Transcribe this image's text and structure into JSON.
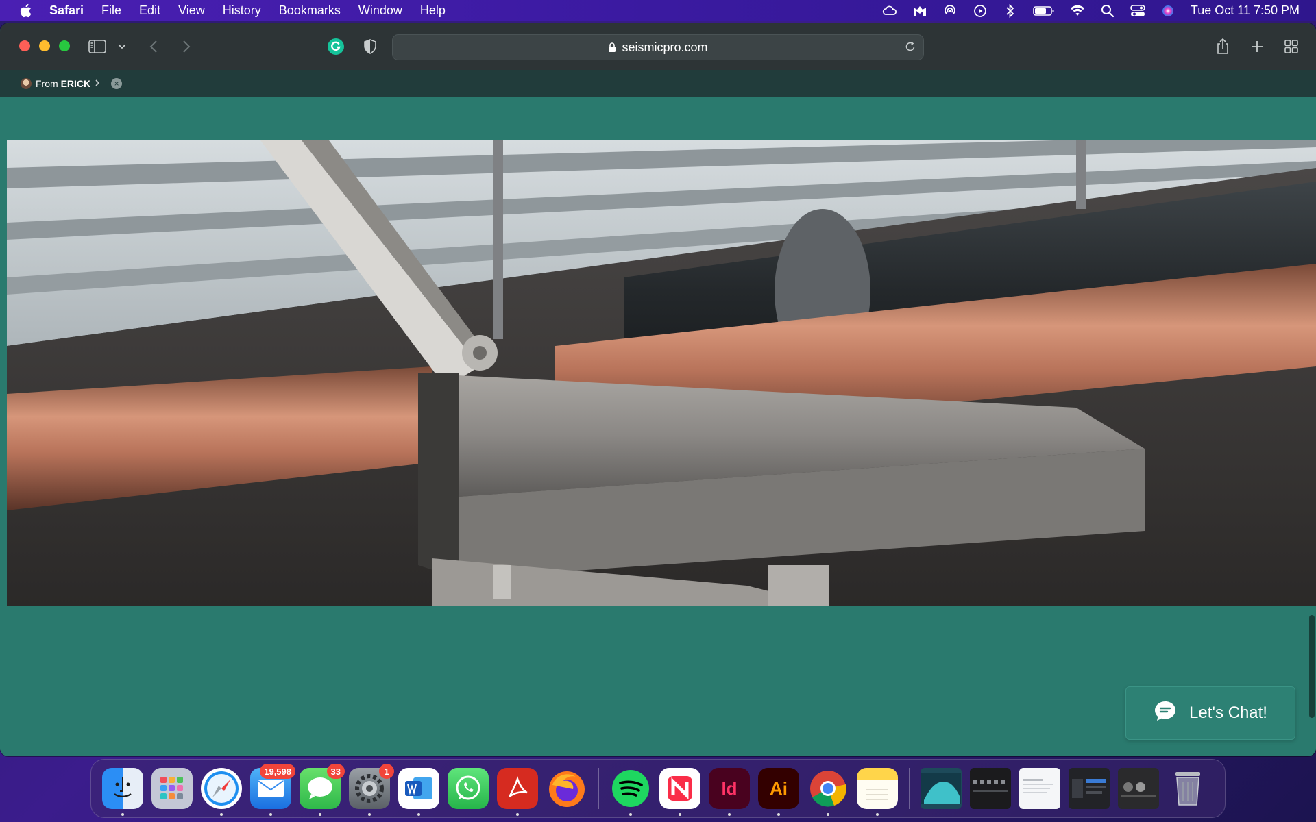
{
  "menubar": {
    "app_name": "Safari",
    "menus": [
      "File",
      "Edit",
      "View",
      "History",
      "Bookmarks",
      "Window",
      "Help"
    ],
    "clock": "Tue Oct 11  7:50 PM"
  },
  "browser": {
    "url": "seismicpro.com",
    "shared_with": {
      "prefix": "From",
      "name": "ERICK"
    }
  },
  "page": {
    "chat_button_label": "Let's Chat!"
  },
  "dock": {
    "badges": {
      "mail": "19,598",
      "messages": "33",
      "settings": "1"
    }
  },
  "colors": {
    "page_bg": "#2a7a6e",
    "toolbar_bg": "#2d3436",
    "menubar_bg": "#3a1aa0"
  }
}
